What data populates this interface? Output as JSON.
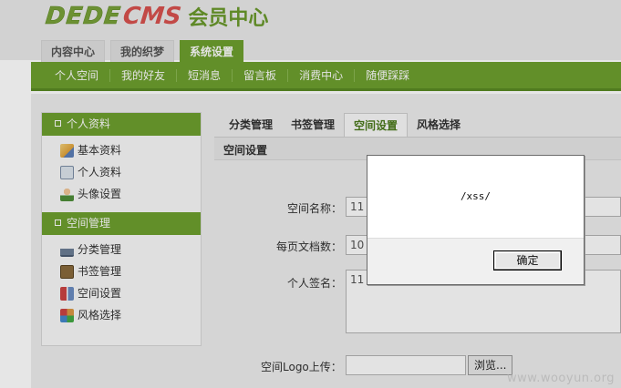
{
  "logo": {
    "part1": "DEDE",
    "part2": "CMS",
    "subtitle": "会员中心"
  },
  "top_tabs": [
    {
      "label": "内容中心",
      "active": false
    },
    {
      "label": "我的织梦",
      "active": false
    },
    {
      "label": "系统设置",
      "active": true
    }
  ],
  "subnav": [
    "个人空间",
    "我的好友",
    "短消息",
    "留言板",
    "消费中心",
    "随便踩踩"
  ],
  "sidebar": {
    "groups": [
      {
        "title": "个人资料",
        "items": [
          {
            "label": "基本资料",
            "icon": "edit-icon"
          },
          {
            "label": "个人资料",
            "icon": "id-card-icon"
          },
          {
            "label": "头像设置",
            "icon": "user-icon"
          }
        ]
      },
      {
        "title": "空间管理",
        "items": [
          {
            "label": "分类管理",
            "icon": "category-icon"
          },
          {
            "label": "书签管理",
            "icon": "bookmark-icon"
          },
          {
            "label": "空间设置",
            "icon": "tools-icon"
          },
          {
            "label": "风格选择",
            "icon": "palette-icon"
          }
        ]
      }
    ]
  },
  "main_tabs": [
    {
      "label": "分类管理",
      "active": false
    },
    {
      "label": "书签管理",
      "active": false
    },
    {
      "label": "空间设置",
      "active": true
    },
    {
      "label": "风格选择",
      "active": false
    }
  ],
  "section_title": "空间设置",
  "form": {
    "space_name_label": "空间名称：",
    "space_name_value": "11",
    "per_page_label": "每页文档数：",
    "per_page_value": "10",
    "signature_label": "个人签名：",
    "signature_value": "11",
    "logo_label": "空间Logo上传：",
    "browse_label": "浏览..."
  },
  "dialog": {
    "message": "/xss/",
    "ok_label": "确定"
  },
  "watermark": "www.wooyun.org",
  "colors": {
    "accent": "#6ea02e",
    "logo_red": "#d9534f"
  }
}
